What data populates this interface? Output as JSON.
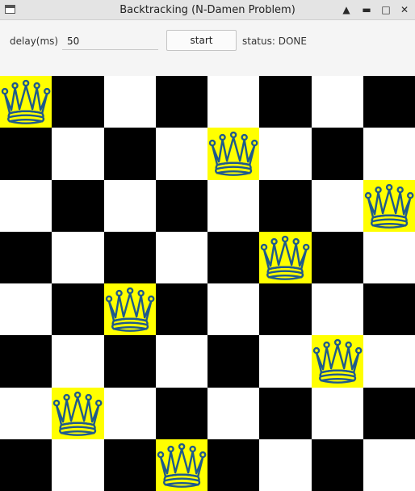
{
  "window": {
    "title": "Backtracking (N-Damen Problem)",
    "help_glyph": "▲",
    "minimize_glyph": "▬",
    "maximize_glyph": "□",
    "close_glyph": "✕"
  },
  "controls": {
    "delay_label": "delay(ms)",
    "delay_value": "50",
    "start_label": "start",
    "status_text": "status: DONE"
  },
  "board": {
    "size": 8,
    "queen_columns": [
      0,
      4,
      7,
      5,
      2,
      6,
      1,
      3
    ],
    "colors": {
      "dark": "#000000",
      "light": "#ffffff",
      "highlight": "#ffff00",
      "queen_outline": "#1e5a8c"
    },
    "queen_icon": "queen-icon"
  }
}
